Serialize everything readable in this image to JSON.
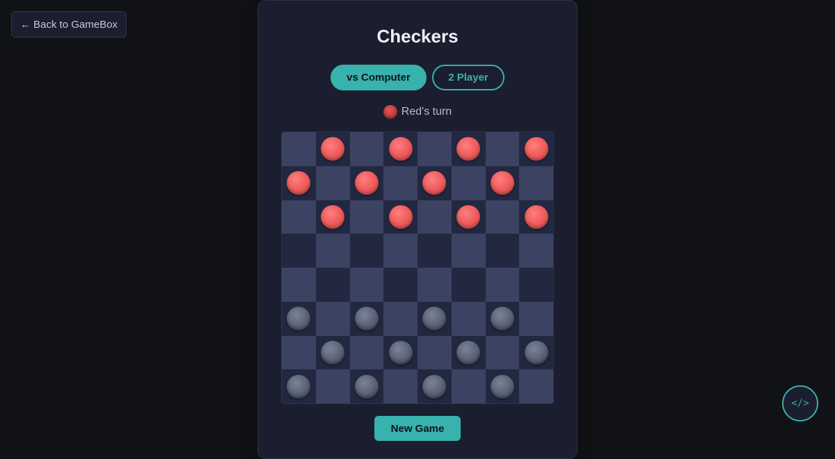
{
  "nav": {
    "back_arrow": "←",
    "back_label": "Back to GameBox"
  },
  "game": {
    "title": "Checkers",
    "modes": [
      {
        "label": "vs Computer",
        "active": true
      },
      {
        "label": "2 Player",
        "active": false
      }
    ],
    "status_text": "Red's turn",
    "new_game_label": "New Game"
  },
  "board": {
    "rows": [
      [
        null,
        "red",
        null,
        "red",
        null,
        "red",
        null,
        "red"
      ],
      [
        "red",
        null,
        "red",
        null,
        "red",
        null,
        "red",
        null
      ],
      [
        null,
        "red",
        null,
        "red",
        null,
        "red",
        null,
        "red"
      ],
      [
        null,
        null,
        null,
        null,
        null,
        null,
        null,
        null
      ],
      [
        null,
        null,
        null,
        null,
        null,
        null,
        null,
        null
      ],
      [
        "black",
        null,
        "black",
        null,
        "black",
        null,
        "black",
        null
      ],
      [
        null,
        "black",
        null,
        "black",
        null,
        "black",
        null,
        "black"
      ],
      [
        "black",
        null,
        "black",
        null,
        "black",
        null,
        "black",
        null
      ]
    ]
  },
  "fab": {
    "icon": "code-icon",
    "glyph": "</>"
  },
  "colors": {
    "accent": "#38b2ac",
    "red_piece": "#f15f5f",
    "black_piece": "#5c6577",
    "light_square": "#3b4262",
    "dark_square": "#232841"
  }
}
